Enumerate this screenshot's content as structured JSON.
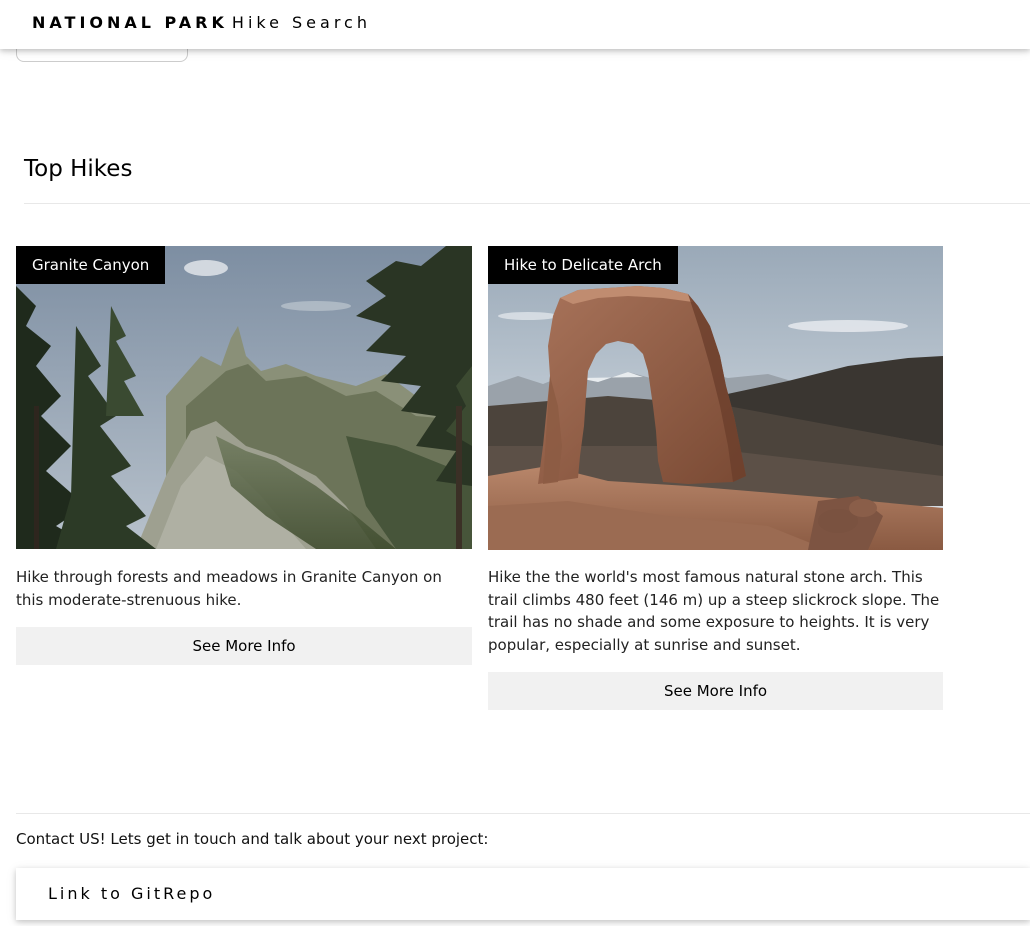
{
  "header": {
    "brand_bold": "NATIONAL PARK",
    "brand_rest": "Hike Search"
  },
  "main": {
    "section_title": "Top Hikes",
    "hikes": [
      {
        "title": "Granite Canyon",
        "description": "Hike through forests and meadows in Granite Canyon on this moderate-strenuous hike.",
        "button_label": "See More Info",
        "image_subject": "mountain-forest-canyon-photo"
      },
      {
        "title": "Hike to Delicate Arch",
        "description": "Hike the the world's most famous natural stone arch. This trail climbs 480 feet (146 m) up a steep slickrock slope. The trail has no shade and some exposure to heights. It is very popular, especially at sunrise and sunset.",
        "button_label": "See More Info",
        "image_subject": "sandstone-arch-photo"
      }
    ]
  },
  "footer": {
    "contact_text": "Contact US! Lets get in touch and talk about your next project:",
    "link_label": "Link to GitRepo"
  },
  "colors": {
    "label_bg": "#000000",
    "label_fg": "#ffffff",
    "button_bg": "#f1f1f1"
  }
}
